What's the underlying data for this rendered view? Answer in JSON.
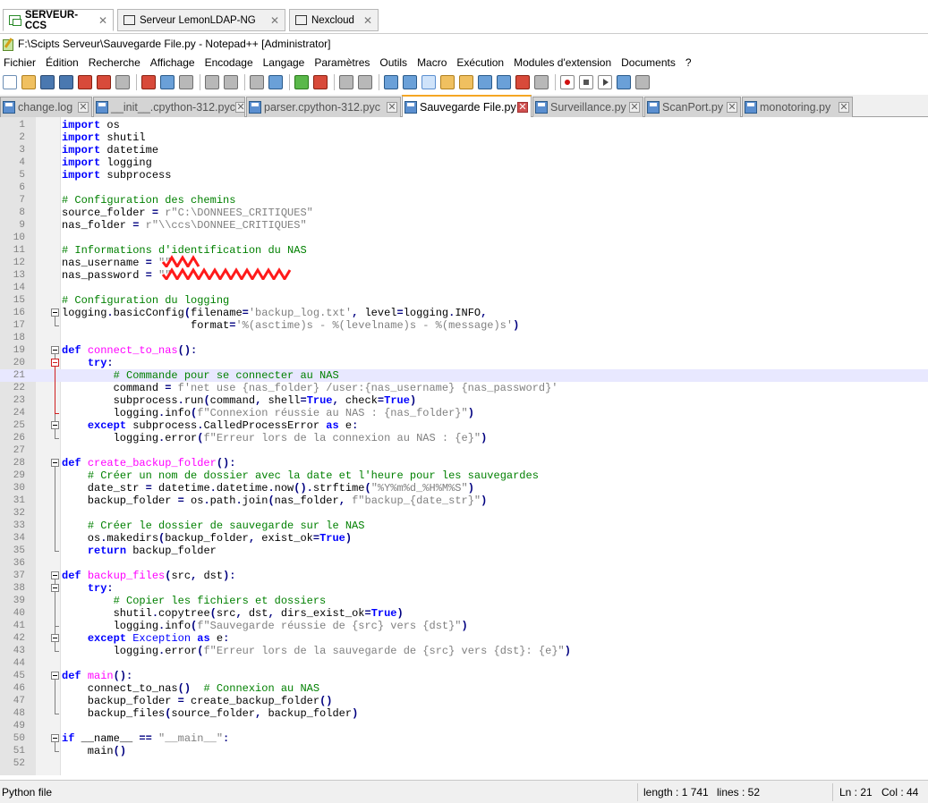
{
  "window_tabs": [
    {
      "label": "SERVEUR-CCS",
      "active": true
    },
    {
      "label": "Serveur LemonLDAP-NG",
      "active": false
    },
    {
      "label": "Nexcloud",
      "active": false
    }
  ],
  "title": "F:\\Scipts Serveur\\Sauvegarde File.py - Notepad++ [Administrator]",
  "menu": [
    "Fichier",
    "Édition",
    "Recherche",
    "Affichage",
    "Encodage",
    "Langage",
    "Paramètres",
    "Outils",
    "Macro",
    "Exécution",
    "Modules d'extension",
    "Documents",
    "?"
  ],
  "doc_tabs": [
    {
      "label": "change.log",
      "active": false
    },
    {
      "label": "__init__.cpython-312.pyc",
      "active": false
    },
    {
      "label": "parser.cpython-312.pyc",
      "active": false
    },
    {
      "label": "Sauvegarde File.py",
      "active": true
    },
    {
      "label": "Surveillance.py",
      "active": false
    },
    {
      "label": "ScanPort.py",
      "active": false
    },
    {
      "label": "monotoring.py",
      "active": false
    }
  ],
  "code_lines": [
    "import os",
    "import shutil",
    "import datetime",
    "import logging",
    "import subprocess",
    "",
    "# Configuration des chemins",
    "source_folder = r\"C:\\DONNEES_CRITIQUES\"",
    "nas_folder = r\"\\\\ccs\\DONNEE_CRITIQUES\"",
    "",
    "# Informations d'identification du NAS",
    "nas_username = \"\"",
    "nas_password = \"\"",
    "",
    "# Configuration du logging",
    "logging.basicConfig(filename='backup_log.txt', level=logging.INFO,",
    "                    format='%(asctime)s - %(levelname)s - %(message)s')",
    "",
    "def connect_to_nas():",
    "    try:",
    "        # Commande pour se connecter au NAS",
    "        command = f'net use {nas_folder} /user:{nas_username} {nas_password}'",
    "        subprocess.run(command, shell=True, check=True)",
    "        logging.info(f\"Connexion réussie au NAS : {nas_folder}\")",
    "    except subprocess.CalledProcessError as e:",
    "        logging.error(f\"Erreur lors de la connexion au NAS : {e}\")",
    "",
    "def create_backup_folder():",
    "    # Créer un nom de dossier avec la date et l'heure pour les sauvegardes",
    "    date_str = datetime.datetime.now().strftime(\"%Y%m%d_%H%M%S\")",
    "    backup_folder = os.path.join(nas_folder, f\"backup_{date_str}\")",
    "",
    "    # Créer le dossier de sauvegarde sur le NAS",
    "    os.makedirs(backup_folder, exist_ok=True)",
    "    return backup_folder",
    "",
    "def backup_files(src, dst):",
    "    try:",
    "        # Copier les fichiers et dossiers",
    "        shutil.copytree(src, dst, dirs_exist_ok=True)",
    "        logging.info(f\"Sauvegarde réussie de {src} vers {dst}\")",
    "    except Exception as e:",
    "        logging.error(f\"Erreur lors de la sauvegarde de {src} vers {dst}: {e}\")",
    "",
    "def main():",
    "    connect_to_nas()  # Connexion au NAS",
    "    backup_folder = create_backup_folder()",
    "    backup_files(source_folder, backup_folder)",
    "",
    "if __name__ == \"__main__\":",
    "    main()",
    ""
  ],
  "current_line": 21,
  "status": {
    "language": "Python file",
    "length": "length : 1 741",
    "lines": "lines : 52",
    "ln": "Ln : 21",
    "col": "Col : 44"
  },
  "colors": {
    "keyword": "#0000ff",
    "comment": "#008000",
    "string": "#808080",
    "function_name": "#ff00ff",
    "current_line_bg": "#e8e8ff",
    "active_tab_accent": "#f5a623"
  }
}
